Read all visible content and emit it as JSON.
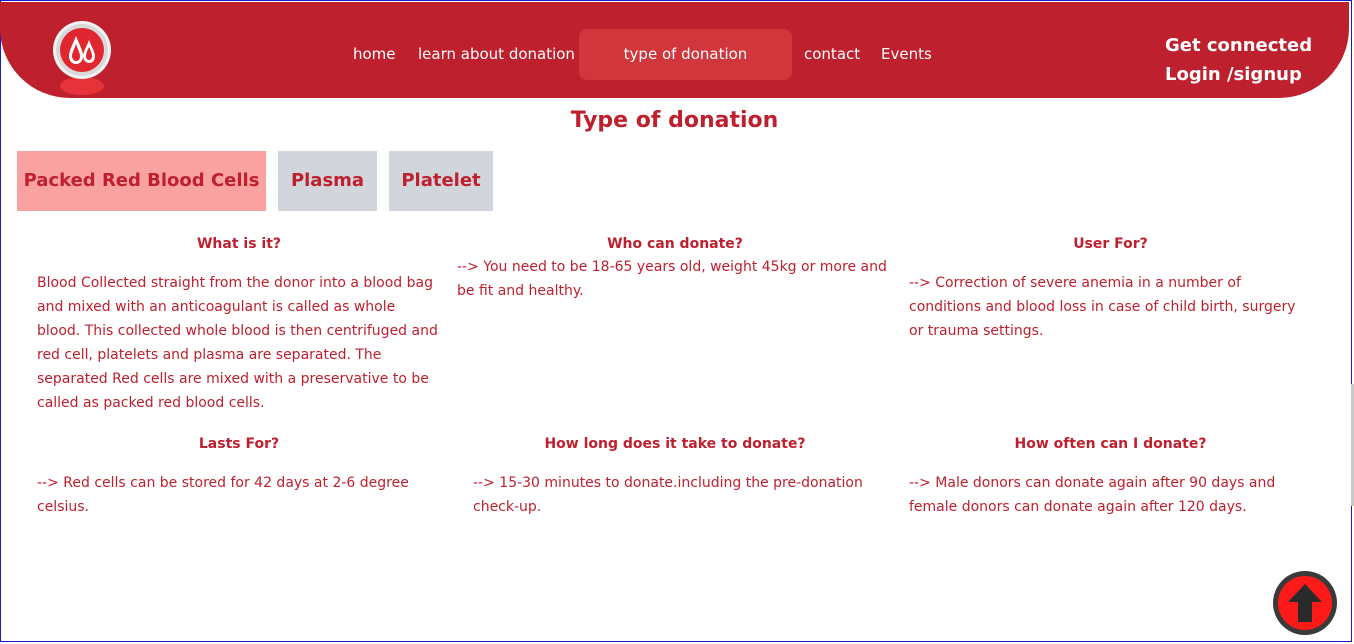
{
  "nav": {
    "items": [
      "home",
      "learn about donation",
      "type of donation",
      "contact",
      "Events"
    ],
    "active": "type of donation"
  },
  "auth": {
    "connect": "Get connected",
    "login": "Login /signup"
  },
  "page_title": "Type of donation",
  "tabs": {
    "items": [
      "Packed Red Blood Cells",
      "Plasma",
      "Platelet"
    ],
    "active": "Packed Red Blood Cells"
  },
  "content": {
    "what_heading": "What is it?",
    "what_text": "Blood Collected straight from the donor into a blood bag and mixed with an anticoagulant is called as whole blood. This collected whole blood is then centrifuged and red cell, platelets and plasma are separated. The separated Red cells are mixed with a preservative to be called as packed red blood cells.",
    "who_heading": "Who can donate?",
    "who_text": "--> You need to be 18-65 years old, weight 45kg or more and be fit and healthy.",
    "used_heading": "User For?",
    "used_text": "--> Correction of severe anemia in a number of conditions and blood loss in case of child birth, surgery or trauma settings.",
    "lasts_heading": "Lasts For?",
    "lasts_text": "--> Red cells can be stored for 42 days at 2-6 degree celsius.",
    "how_long_heading": "How long does it take to donate?",
    "how_long_text": "--> 15-30 minutes to donate.including the pre-donation check-up.",
    "how_often_heading": "How often can I donate?",
    "how_often_text": "--> Male donors can donate again after 90 days and female donors can donate again after 120 days."
  },
  "colors": {
    "brand": "#be202d",
    "active_tab": "#faa2a2",
    "inactive_tab": "#d3d5dc",
    "scroll_button": "#ff1a1a"
  },
  "icons": {
    "logo": "blood-drop-logo",
    "scroll_top": "arrow-up-icon"
  }
}
